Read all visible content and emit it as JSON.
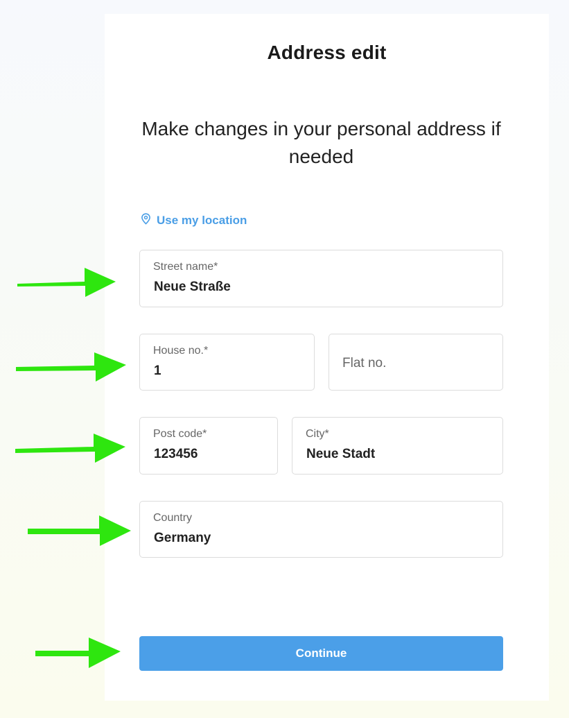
{
  "header": {
    "title": "Address edit"
  },
  "intro": {
    "text": "Make changes in your personal address if needed"
  },
  "location_link": {
    "label": "Use my location",
    "icon": "map-pin-icon",
    "color": "#4a9ee6"
  },
  "form": {
    "street": {
      "label": "Street name*",
      "value": "Neue Straße"
    },
    "house": {
      "label": "House no.*",
      "value": "1"
    },
    "flat": {
      "placeholder": "Flat no."
    },
    "postcode": {
      "label": "Post code*",
      "value": "123456"
    },
    "city": {
      "label": "City*",
      "value": "Neue Stadt"
    },
    "country": {
      "label": "Country",
      "value": "Germany"
    }
  },
  "continue_button": {
    "label": "Continue",
    "color": "#4b9fe8"
  },
  "annotation_arrows": {
    "color": "#2ee60f",
    "count": 5
  }
}
